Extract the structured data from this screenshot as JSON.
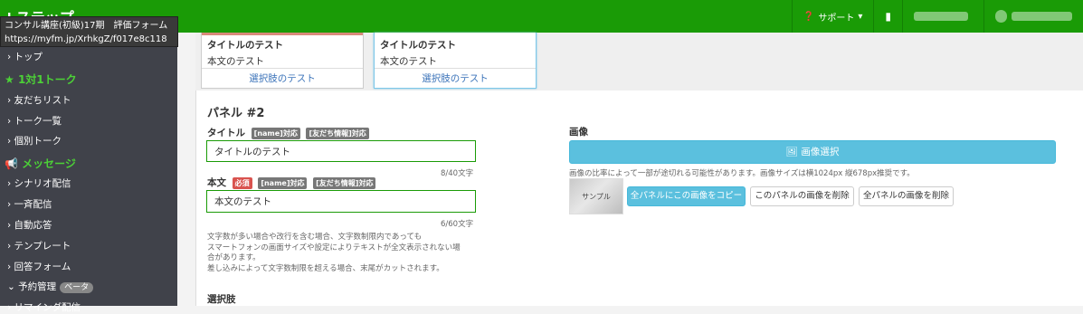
{
  "header": {
    "brand": "Lステップ",
    "support": "サポート",
    "tooltip_line1": "コンサル講座(初級)17期　評価フォーム",
    "tooltip_line2": "https://myfm.jp/XrhkgZ/f017e8c118"
  },
  "sidebar": {
    "items": [
      {
        "label": "トップ"
      },
      {
        "section": "1対1トーク"
      },
      {
        "label": "友だちリスト"
      },
      {
        "label": "トーク一覧"
      },
      {
        "label": "個別トーク"
      },
      {
        "section": "メッセージ"
      },
      {
        "label": "シナリオ配信"
      },
      {
        "label": "一斉配信"
      },
      {
        "label": "自動応答"
      },
      {
        "label": "テンプレート"
      },
      {
        "label": "回答フォーム"
      },
      {
        "label": "予約管理",
        "badge": "ベータ"
      },
      {
        "label": "リマインダ配信"
      }
    ]
  },
  "preview_cards": [
    {
      "title": "タイトルのテスト",
      "body": "本文のテスト",
      "choice": "選択肢のテスト"
    },
    {
      "title": "タイトルのテスト",
      "body": "本文のテスト",
      "choice": "選択肢のテスト"
    }
  ],
  "panel": {
    "heading": "パネル #2",
    "title_label": "タイトル",
    "name_tag": "[name]対応",
    "friend_tag": "[友だち情報]対応",
    "title_value": "タイトルのテスト",
    "title_counter": "8/40文字",
    "body_label": "本文",
    "required_tag": "必須",
    "body_value": "本文のテスト",
    "body_counter": "6/60文字",
    "help_text_1": "文字数が多い場合や改行を含む場合、文字数制限内であっても",
    "help_text_2": "スマートフォンの画面サイズや設定によりテキストが全文表示されない場",
    "help_text_3": "合があります。",
    "help_text_4": "差し込みによって文字数制限を超える場合、末尾がカットされます。",
    "choices_label": "選択肢",
    "image_label": "画像",
    "image_select": "画像選択",
    "image_note": "画像の比率によって一部が途切れる可能性があります。画像サイズは横1024px 縦678px推奨です。",
    "thumb_text": "サンプル",
    "copy_all": "全パネルにこの画像をコピー",
    "delete_this": "このパネルの画像を削除",
    "delete_all": "全パネルの画像を削除"
  },
  "colors": {
    "brand_green": "#1a9b06",
    "info_blue": "#5bc0de",
    "sidebar_bg": "#40424a"
  }
}
